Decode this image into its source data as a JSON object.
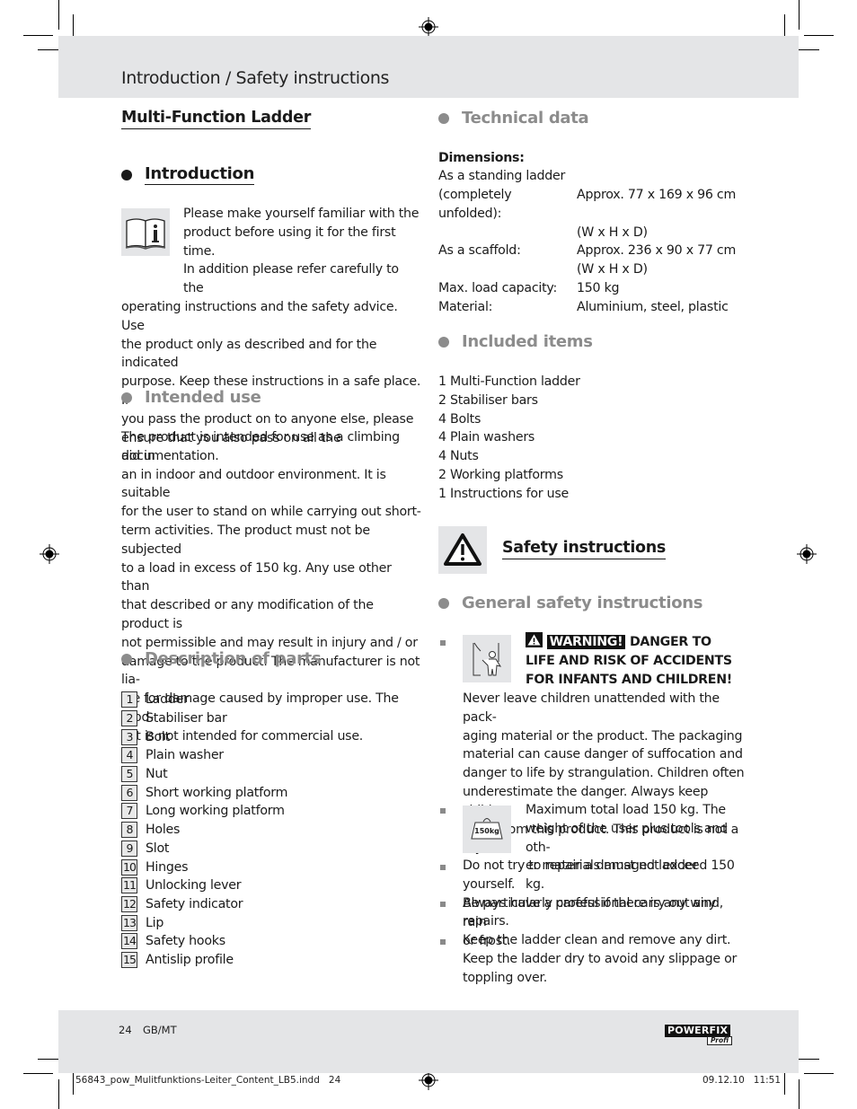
{
  "header": {
    "title": "Introduction / Safety instructions"
  },
  "left_column": {
    "product_title": "Multi-Function Ladder",
    "introduction": {
      "heading": "Introduction",
      "icon": "info-book-icon",
      "lines": [
        "Please make yourself familiar with the",
        "product before using it for the first time.",
        "In addition please refer carefully to the",
        "operating instructions and the safety advice. Use",
        "the product only as described and for the indicated",
        "purpose. Keep these instructions in a safe place. If",
        "you pass the product on to anyone else, please",
        "ensure that you also pass on all the documentation."
      ]
    },
    "intended_use": {
      "heading": "Intended use",
      "lines": [
        "The product is intended for use as a climbing aid in",
        "an in indoor and outdoor environment. It is suitable",
        "for the user to stand on while carrying out short-",
        "term activities. The product must not be subjected",
        "to a load in excess of 150 kg. Any use other than",
        "that described or any modification of the product is",
        "not permissible and may result in injury and / or",
        "damage to the product. The manufacturer is not lia-",
        "ble for damage caused by improper use. The prod-",
        "uct is not intended for commercial use."
      ]
    },
    "description_of_parts": {
      "heading": "Description of parts",
      "parts": [
        {
          "num": "1",
          "label": "Ladder"
        },
        {
          "num": "2",
          "label": "Stabiliser bar"
        },
        {
          "num": "3",
          "label": "Bolt"
        },
        {
          "num": "4",
          "label": "Plain washer"
        },
        {
          "num": "5",
          "label": "Nut"
        },
        {
          "num": "6",
          "label": "Short working platform"
        },
        {
          "num": "7",
          "label": "Long working platform"
        },
        {
          "num": "8",
          "label": "Holes"
        },
        {
          "num": "9",
          "label": "Slot"
        },
        {
          "num": "10",
          "label": "Hinges"
        },
        {
          "num": "11",
          "label": "Unlocking lever"
        },
        {
          "num": "12",
          "label": "Safety indicator"
        },
        {
          "num": "13",
          "label": "Lip"
        },
        {
          "num": "14",
          "label": "Safety hooks"
        },
        {
          "num": "15",
          "label": "Antislip profile"
        }
      ]
    }
  },
  "right_column": {
    "technical_data": {
      "heading": "Technical data",
      "dimensions_label": "Dimensions:",
      "standing_label": "As a standing ladder",
      "rows": [
        {
          "key": "(completely unfolded):",
          "value": "Approx. 77 x 169 x 96 cm",
          "value2": "(W x H x D)"
        },
        {
          "key": "As a scaffold:",
          "value": "Approx. 236 x 90 x 77 cm",
          "value2": "(W x H x D)"
        },
        {
          "key": "Max. load capacity:",
          "value": "150 kg",
          "value2": ""
        },
        {
          "key": "Material:",
          "value": "Aluminium, steel, plastic",
          "value2": ""
        }
      ]
    },
    "included_items": {
      "heading": "Included items",
      "items": [
        "1 Multi-Function ladder",
        "2 Stabiliser bars",
        "4 Bolts",
        "4 Plain washers",
        "4 Nuts",
        "2 Working platforms",
        "1 Instructions for use"
      ]
    },
    "safety_instructions": {
      "heading": "Safety instructions",
      "icon": "warning-triangle-icon"
    },
    "general_safety": {
      "heading": "General safety instructions",
      "warning": {
        "tag": "WARNING!",
        "title_lines": [
          "DANGER TO",
          "LIFE AND RISK OF ACCIDENTS",
          "FOR INFANTS AND CHILDREN!"
        ],
        "icon": "child-hazard-icon",
        "lines": [
          "Never leave children unattended with the pack-",
          "aging material or the product. The packaging",
          "material can cause danger of suffocation and",
          "danger to life by strangulation. Children often",
          "underestimate the danger. Always keep children",
          "away from this product. This product is not a toy."
        ]
      },
      "load": {
        "icon": "weight-150kg-icon",
        "icon_label": "150kg",
        "lines": [
          "Maximum total load 150 kg. The",
          "weight of the user plus tools and oth-",
          "er materials must not exceed 150 kg."
        ]
      },
      "bullets": [
        [
          "Do not try to repair a damaged ladder yourself.",
          "Always have a professional carry out any repairs."
        ],
        [
          "Be particularly careful if there is any wind, rain",
          "or frost."
        ],
        [
          "Keep the ladder clean and remove any dirt.",
          "Keep the ladder dry to avoid any slippage or",
          "toppling over."
        ]
      ]
    }
  },
  "footer": {
    "page": "24",
    "locale": "GB/MT",
    "brand": "POWERFIX",
    "brand_sub": "Profi",
    "file": "56843_pow_Mulitfunktions-Leiter_Content_LB5.indd   24",
    "date": "09.12.10   11:51"
  },
  "colors": {
    "band": "#e4e5e7",
    "heading_gray": "#8c8c8c",
    "text": "#1a1a1a"
  }
}
